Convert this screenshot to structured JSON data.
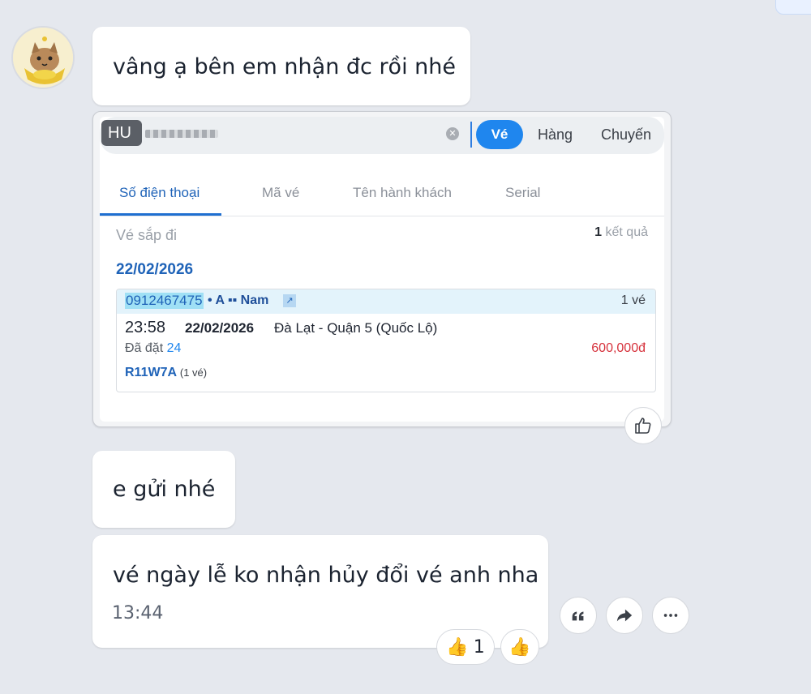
{
  "messages": [
    {
      "text": "vâng ạ bên em nhận đc rồi nhé"
    },
    {
      "text": "e gửi nhé"
    },
    {
      "text": "vé ngày lễ ko nhận hủy đổi vé anh nha",
      "time": "13:44"
    }
  ],
  "screenshot": {
    "search": {
      "prefix_tag": "HU",
      "segments": [
        "Vé",
        "Hàng",
        "Chuyến"
      ]
    },
    "tabs": [
      "Số điện thoại",
      "Mã vé",
      "Tên hành khách",
      "Serial"
    ],
    "section_label": "Vé sắp đi",
    "result_count_num": "1",
    "result_count_label": "kết quả",
    "date_heading": "22/02/2026",
    "ticket": {
      "phone": "0912467475",
      "passenger": "• A ▪▪ Nam",
      "ticket_count": "1 vé",
      "time": "23:58",
      "date": "22/02/2026",
      "route": "Đà Lạt - Quận 5 (Quốc Lộ)",
      "booked_label": "Đã đặt",
      "booked_num": "24",
      "price": "600,000đ",
      "code": "R11W7A",
      "code_suffix": "(1 vé)"
    }
  },
  "reactions": {
    "like_count": "1"
  },
  "icons": {
    "thumb": "thumbs-up-icon",
    "quote": "quote-icon",
    "share": "share-icon",
    "more": "more-icon"
  },
  "colors": {
    "accent": "#1f86ee",
    "price": "#d6323c",
    "background": "#e5e8ee"
  }
}
